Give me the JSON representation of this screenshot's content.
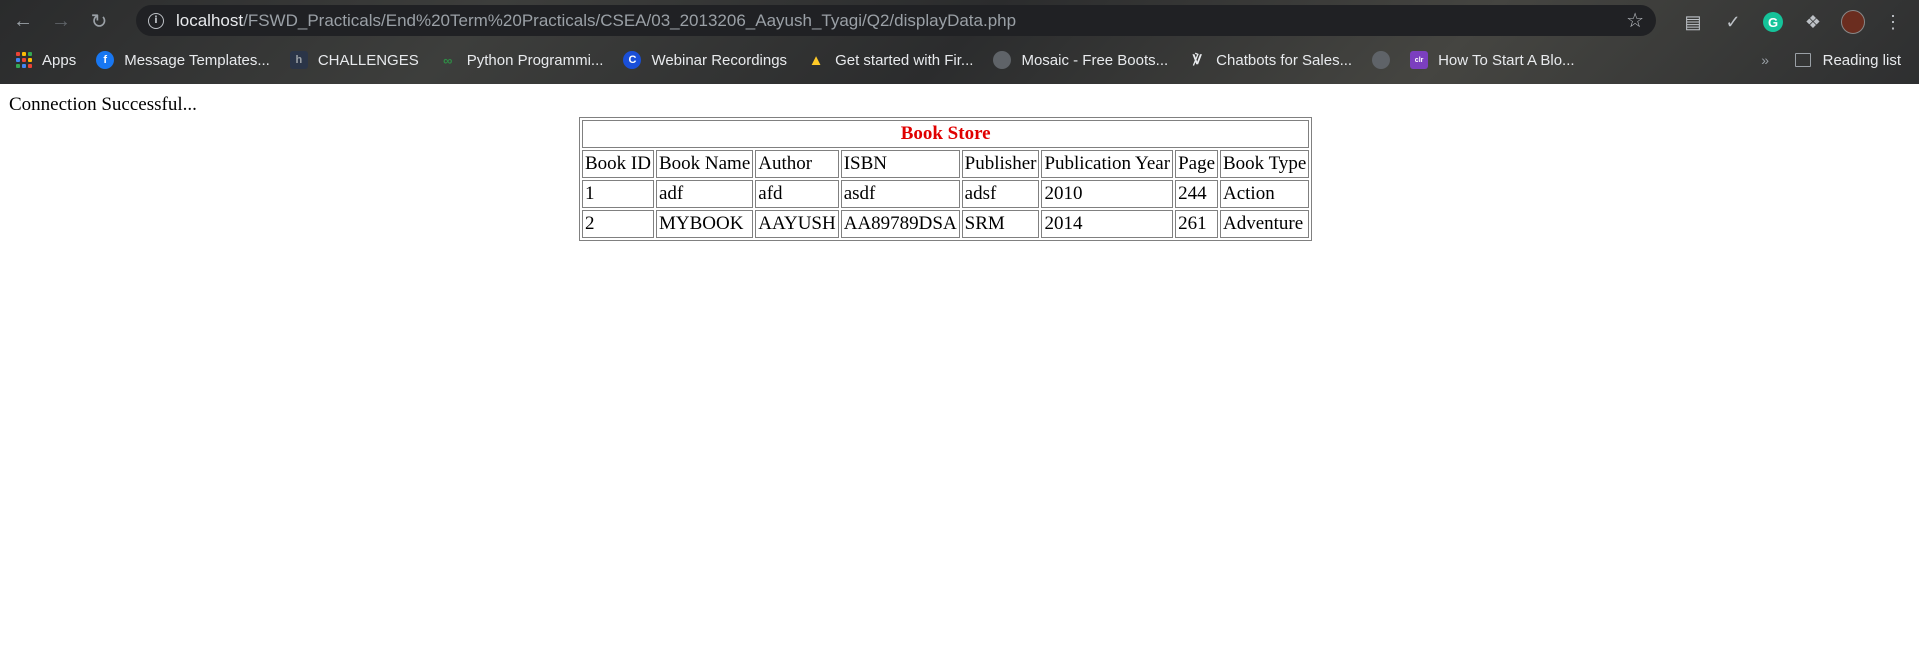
{
  "browser": {
    "url_host": "localhost",
    "url_path": "/FSWD_Practicals/End%20Term%20Practicals/CSEA/03_2013206_Aayush_Tyagi/Q2/displayData.php",
    "bookmarks": [
      {
        "label": "Apps",
        "icon": "apps-grid-icon"
      },
      {
        "label": "Message Templates...",
        "icon": "facebook-icon"
      },
      {
        "label": "CHALLENGES",
        "icon": "hackerrank-icon"
      },
      {
        "label": "Python Programmi...",
        "icon": "geeksforgeeks-icon"
      },
      {
        "label": "Webinar Recordings",
        "icon": "c-logo-icon"
      },
      {
        "label": "Get started with Fir...",
        "icon": "firebase-icon"
      },
      {
        "label": "Mosaic - Free Boots...",
        "icon": "globe-icon"
      },
      {
        "label": "Chatbots for Sales...",
        "icon": "chatbot-icon"
      },
      {
        "label": "",
        "icon": "globe-icon"
      },
      {
        "label": "How To Start A Blo...",
        "icon": "colorlib-icon"
      }
    ],
    "reading_list": "Reading list"
  },
  "page": {
    "status": "Connection Successful...",
    "table_title": "Book Store",
    "columns": [
      "Book ID",
      "Book Name",
      "Author",
      "ISBN",
      "Publisher",
      "Publication Year",
      "Page",
      "Book Type"
    ],
    "rows": [
      [
        "1",
        "adf",
        "afd",
        "asdf",
        "adsf",
        "2010",
        "244",
        "Action"
      ],
      [
        "2",
        "MYBOOK",
        "AAYUSH",
        "AA89789DSA",
        "SRM",
        "2014",
        "261",
        "Adventure"
      ]
    ]
  },
  "colors": {
    "title_red": "#e00000",
    "chrome_dark": "#202124"
  }
}
